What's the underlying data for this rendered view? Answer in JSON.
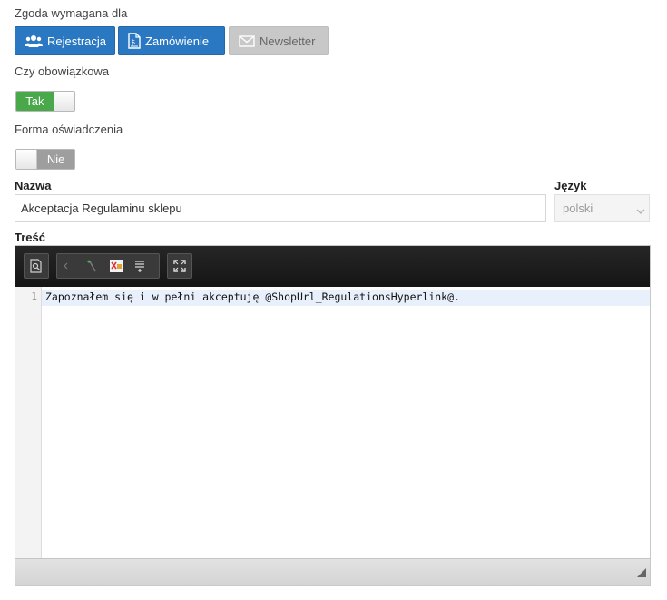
{
  "consent": {
    "label": "Zgoda wymagana dla",
    "buttons": [
      {
        "label": "Rejestracja",
        "icon": "users-icon",
        "state": "active"
      },
      {
        "label": "Zamówienie",
        "icon": "document-icon",
        "state": "active"
      },
      {
        "label": "Newsletter",
        "icon": "envelope-icon",
        "state": "inactive"
      }
    ]
  },
  "required": {
    "label": "Czy obowiązkowa",
    "toggle_text": "Tak",
    "value": true
  },
  "statement_form": {
    "label": "Forma oświadczenia",
    "toggle_text": "Nie",
    "value": false
  },
  "name": {
    "label": "Nazwa",
    "value": "Akceptacja Regulaminu sklepu"
  },
  "language": {
    "label": "Język",
    "value": "polski"
  },
  "content": {
    "label": "Treść",
    "toolbar_icons": [
      "preview-icon",
      "code-tag-icon",
      "wand-icon",
      "image-icon",
      "align-icon",
      "fullscreen-icon"
    ],
    "line_number": "1",
    "code": "Zapoznałem się i w pełni akceptuję @ShopUrl_RegulationsHyperlink@."
  },
  "colors": {
    "primary": "#2b78c2",
    "toggle_on": "#48a84a",
    "toggle_off": "#9e9e9e"
  }
}
